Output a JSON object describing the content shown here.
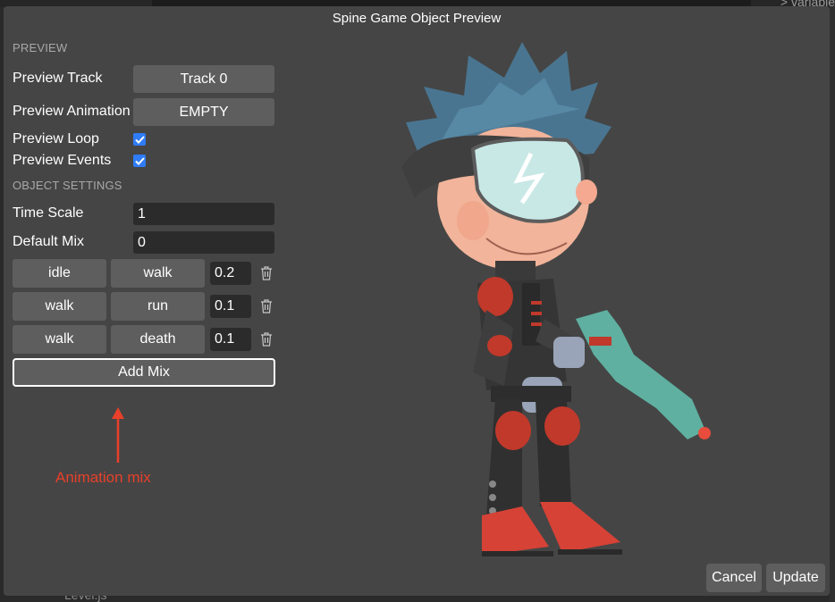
{
  "dialog": {
    "title": "Spine Game Object Preview"
  },
  "preview": {
    "section_title": "PREVIEW",
    "track_label": "Preview Track",
    "track_value": "Track 0",
    "animation_label": "Preview Animation",
    "animation_value": "EMPTY",
    "loop_label": "Preview Loop",
    "loop_checked": true,
    "events_label": "Preview Events",
    "events_checked": true
  },
  "object_settings": {
    "section_title": "OBJECT SETTINGS",
    "time_scale_label": "Time Scale",
    "time_scale_value": "1",
    "default_mix_label": "Default Mix",
    "default_mix_value": "0"
  },
  "mixes": [
    {
      "from": "idle",
      "to": "walk",
      "duration": "0.2"
    },
    {
      "from": "walk",
      "to": "run",
      "duration": "0.1"
    },
    {
      "from": "walk",
      "to": "death",
      "duration": "0.1"
    }
  ],
  "add_mix_label": "Add Mix",
  "annotation": {
    "text": "Animation mix",
    "color": "#e8402a"
  },
  "footer": {
    "cancel_label": "Cancel",
    "update_label": "Update"
  },
  "background": {
    "right_text": "> variable",
    "bottom_text": "Level.js"
  },
  "colors": {
    "dialog_bg": "#454545",
    "button_bg": "#5e5e5e",
    "input_bg": "#2b2b2b",
    "checkbox": "#2f7cf6"
  }
}
